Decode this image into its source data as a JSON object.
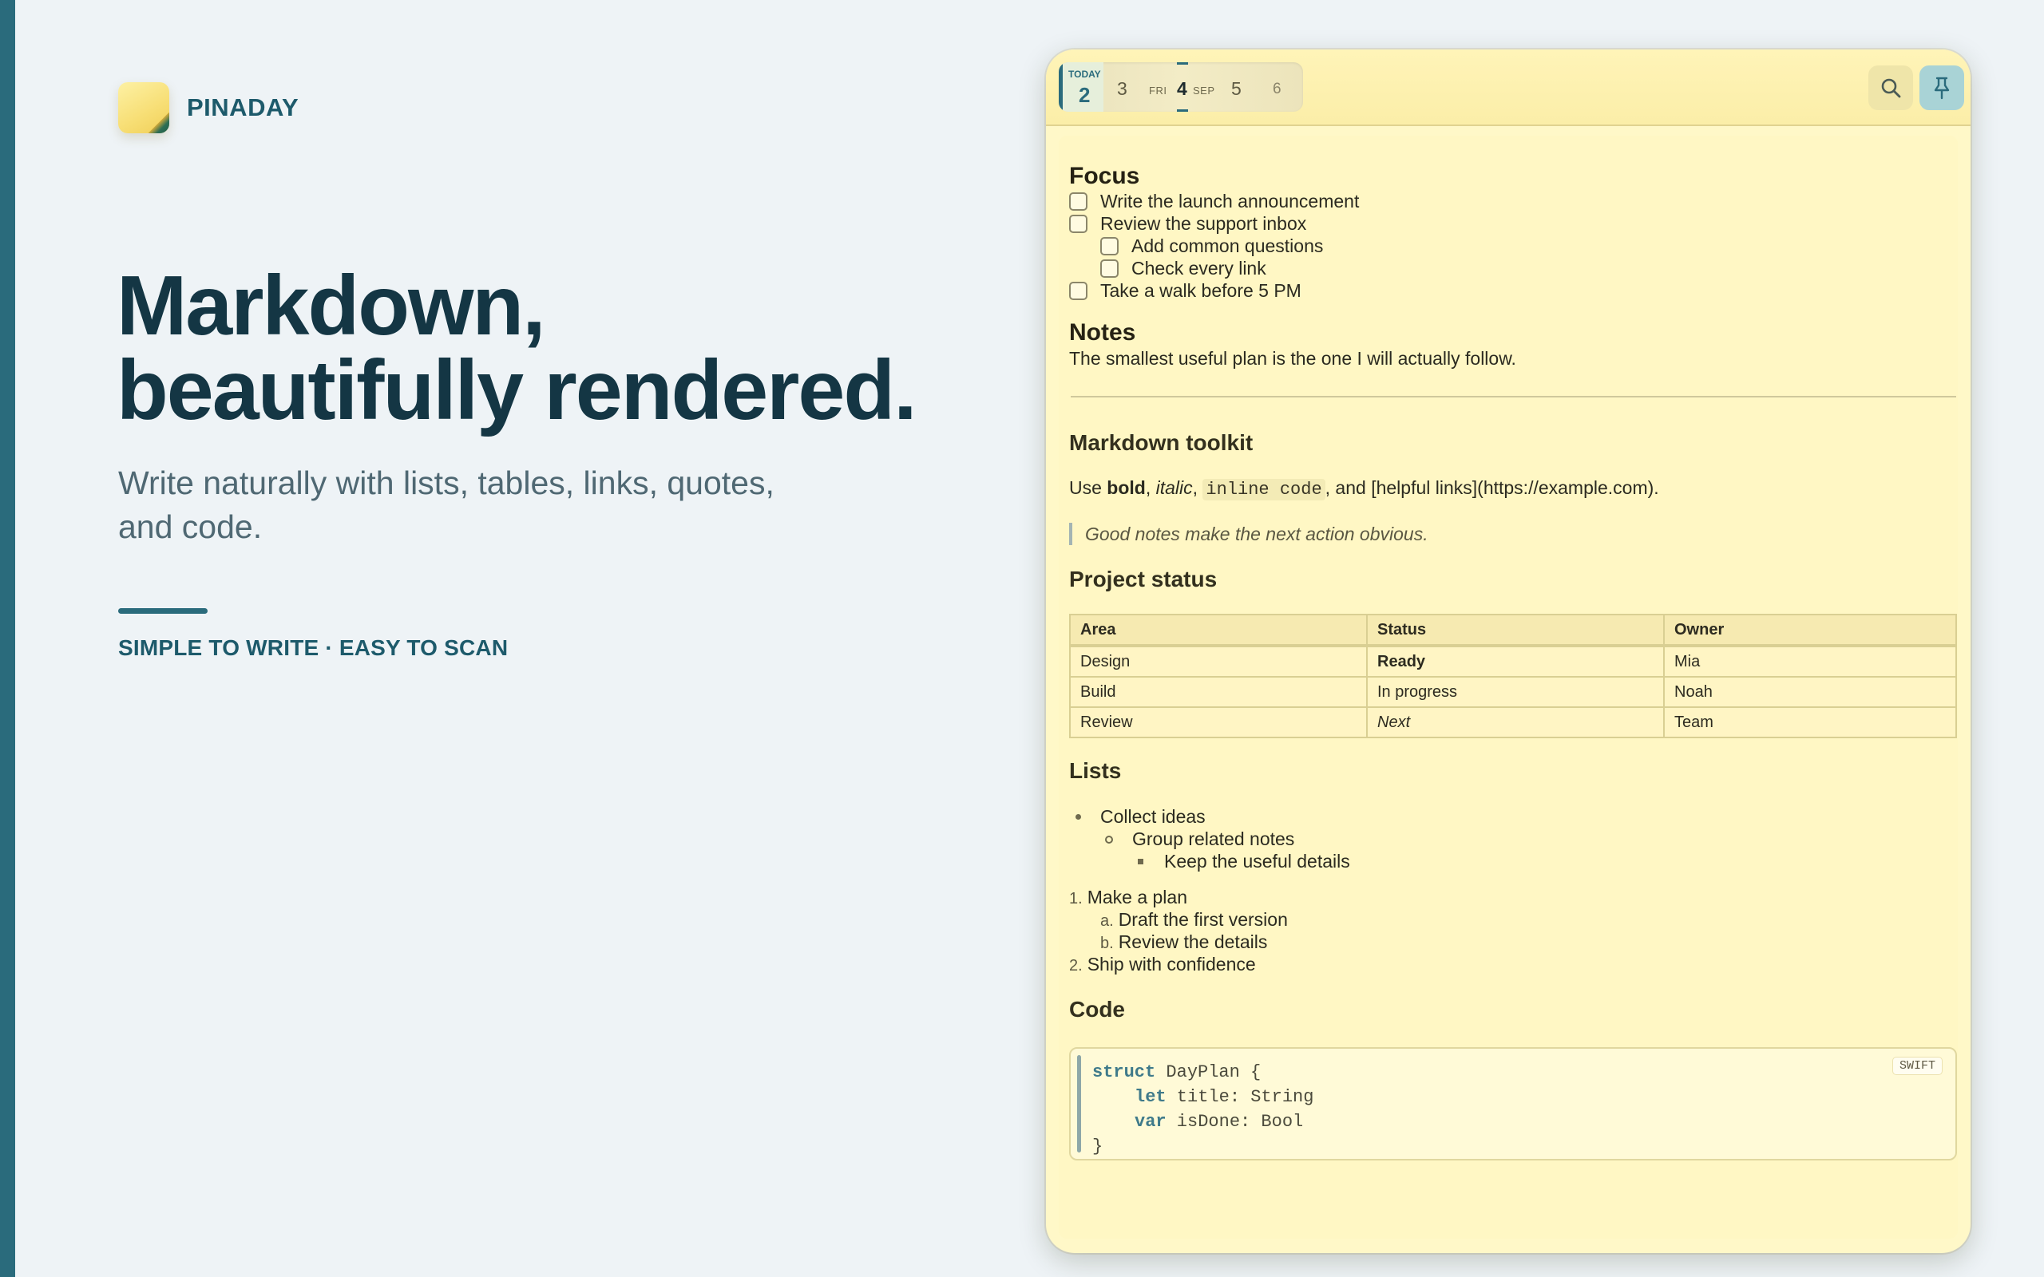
{
  "brand": {
    "name": "PINADAY"
  },
  "hero": {
    "line1": "Markdown,",
    "line2": "beautifully rendered."
  },
  "subtitle": "Write naturally with lists, tables, links, quotes, and code.",
  "tagline": "SIMPLE TO WRITE · EASY TO SCAN",
  "toolbar": {
    "today_label": "TODAY",
    "dates": {
      "today": "2",
      "d3": "3",
      "weekday": "FRI",
      "selected": "4",
      "month": "SEP",
      "d5": "5",
      "d6": "6"
    },
    "icons": {
      "search": "search-icon",
      "pin": "pin-icon"
    }
  },
  "note": {
    "focus": {
      "heading": "Focus",
      "tasks": [
        "Write the launch announcement",
        "Review the support inbox",
        "Add common questions",
        "Check every link",
        "Take a walk before 5 PM"
      ]
    },
    "notes": {
      "heading": "Notes",
      "text": "The smallest useful plan is the one I will actually follow."
    },
    "toolkit": {
      "heading": "Markdown toolkit",
      "use": "Use",
      "bold": "bold",
      "comma1": ",",
      "italic": "italic",
      "comma2": ",",
      "code": "inline code",
      "tail": ", and [helpful links](https://example.com).",
      "quote": "Good notes make the next action obvious."
    },
    "project": {
      "heading": "Project status",
      "columns": [
        "Area",
        "Status",
        "Owner"
      ],
      "rows": [
        [
          "Design",
          "Ready",
          "Mia"
        ],
        [
          "Build",
          "In progress",
          "Noah"
        ],
        [
          "Review",
          "Next",
          "Team"
        ]
      ]
    },
    "lists": {
      "heading": "Lists",
      "bullets": [
        "Collect ideas",
        "Group related notes",
        "Keep the useful details"
      ],
      "ordered": [
        {
          "marker": "1.",
          "text": "Make a plan"
        },
        {
          "marker": "a.",
          "text": "Draft the first version"
        },
        {
          "marker": "b.",
          "text": "Review the details"
        },
        {
          "marker": "2.",
          "text": "Ship with confidence"
        }
      ]
    },
    "code": {
      "heading": "Code",
      "lang": "SWIFT",
      "lines": [
        {
          "kw": "struct",
          "rest": " DayPlan {"
        },
        {
          "kw": "let",
          "rest": " title: String"
        },
        {
          "kw": "var",
          "rest": " isDone: Bool"
        },
        {
          "kw": "",
          "rest": "}"
        }
      ]
    }
  },
  "colors": {
    "accent": "#2a6b7c",
    "note_bg": "#fff8c8",
    "page_bg": "#eef3f6"
  }
}
